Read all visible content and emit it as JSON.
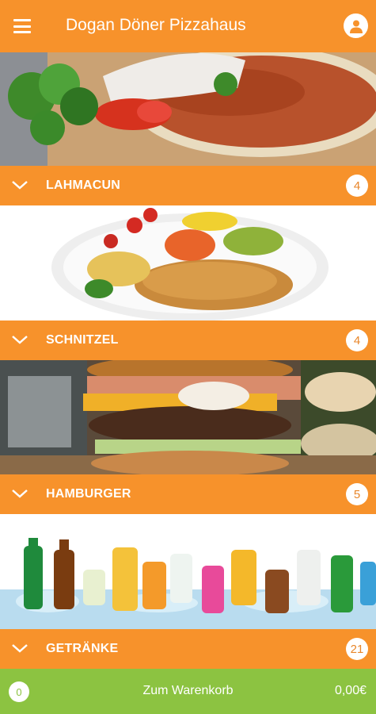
{
  "header": {
    "title": "Dogan Döner Pizzahaus",
    "menu_icon": "hamburger-menu-icon",
    "account_icon": "user-icon"
  },
  "categories": [
    {
      "label": "LAHMACUN",
      "count": "4",
      "image": "lahmacun-photo"
    },
    {
      "label": "SCHNITZEL",
      "count": "4",
      "image": "schnitzel-photo"
    },
    {
      "label": "HAMBURGER",
      "count": "5",
      "image": "hamburger-photo"
    },
    {
      "label": "GETRÄNKE",
      "count": "21",
      "image": "drinks-photo"
    }
  ],
  "cart": {
    "count": "0",
    "label": "Zum Warenkorb",
    "total": "0,00€"
  },
  "colors": {
    "accent": "#f7922b",
    "cart": "#8cc341"
  }
}
